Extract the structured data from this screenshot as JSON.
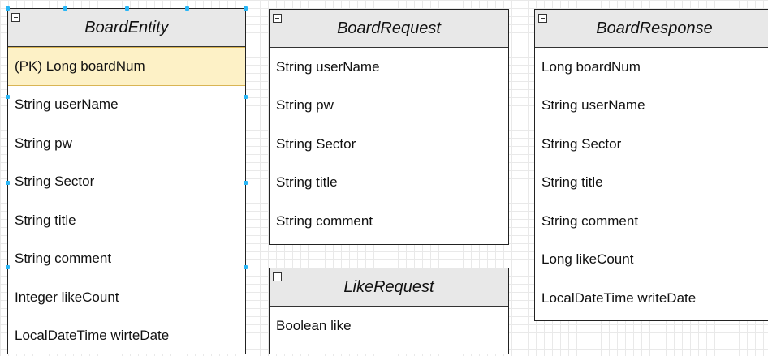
{
  "entities": {
    "board_entity": {
      "title": "BoardEntity",
      "fields": [
        "(PK) Long boardNum",
        "String userName",
        "String pw",
        "String Sector",
        "String title",
        "String comment",
        "Integer likeCount",
        "LocalDateTime wirteDate"
      ]
    },
    "board_request": {
      "title": "BoardRequest",
      "fields": [
        "String userName",
        "String pw",
        "String Sector",
        "String title",
        "String comment"
      ]
    },
    "like_request": {
      "title": "LikeRequest",
      "fields": [
        "Boolean like"
      ]
    },
    "board_response": {
      "title": "BoardResponse",
      "fields": [
        "Long boardNum",
        "String userName",
        "String Sector",
        "String title",
        "String comment",
        "Long likeCount",
        "LocalDateTime writeDate"
      ]
    }
  },
  "colors": {
    "header_bg": "#e8e8e8",
    "pk_row_bg": "#fdf1c6",
    "selection_handle": "#29b6f6"
  }
}
